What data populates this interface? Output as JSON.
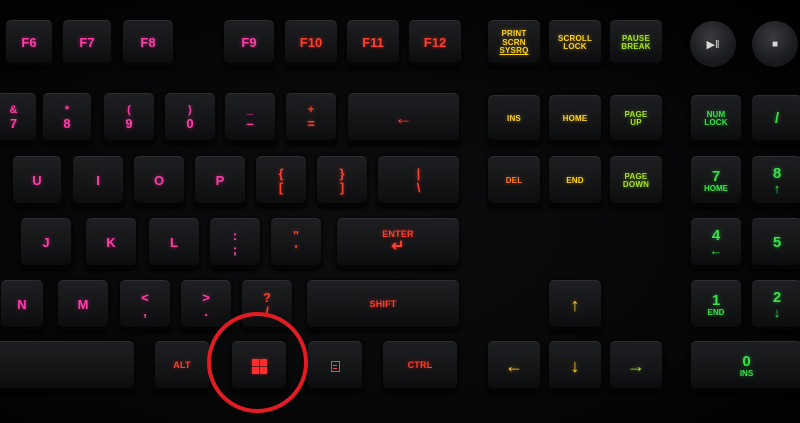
{
  "fkeys": {
    "f6": "F6",
    "f7": "F7",
    "f8": "F8",
    "f9": "F9",
    "f10": "F10",
    "f11": "F11",
    "f12": "F12"
  },
  "system": {
    "print_l1": "PRINT",
    "print_l2": "SCRN",
    "print_l3": "SYSRQ",
    "scroll_l1": "SCROLL",
    "scroll_l2": "LOCK",
    "pause_l1": "PAUSE",
    "pause_l2": "BREAK"
  },
  "media": {
    "play_pause": "▶ǁ",
    "stop": "■"
  },
  "numrow": {
    "k7_top": "&",
    "k7": "7",
    "k8_top": "*",
    "k8": "8",
    "k9_top": "(",
    "k9": "9",
    "k0_top": ")",
    "k0": "0",
    "minus_top": "_",
    "minus": "–",
    "equal_top": "+",
    "equal": "=",
    "backspace": "←"
  },
  "nav": {
    "ins": "INS",
    "home": "HOME",
    "pgup_l1": "PAGE",
    "pgup_l2": "UP",
    "del": "DEL",
    "end": "END",
    "pgdn_l1": "PAGE",
    "pgdn_l2": "DOWN"
  },
  "numpad": {
    "numlock_l1": "NUM",
    "numlock_l2": "LOCK",
    "slash": "/",
    "n7": "7",
    "n7_sub": "HOME",
    "n8": "8",
    "n8_sub": "↑",
    "n4": "4",
    "n4_sub": "←",
    "n5": "5",
    "n1": "1",
    "n1_sub": "END",
    "n2": "2",
    "n2_sub": "↓",
    "n0": "0",
    "n0_sub": "INS"
  },
  "toprow": {
    "u": "U",
    "i": "I",
    "o": "O",
    "p": "P",
    "lbrace_top": "{",
    "lbrace": "[",
    "rbrace_top": "}",
    "rbrace": "]",
    "pipe_top": "|",
    "pipe": "\\"
  },
  "homerow": {
    "j": "J",
    "k": "K",
    "l": "L",
    "colon_top": ":",
    "colon": ";",
    "quote_top": "\"",
    "quote": "'",
    "enter": "ENTER",
    "enter_arrow": "↵"
  },
  "bottomrow": {
    "n": "N",
    "m": "M",
    "lt": "<",
    "comma": ",",
    "gt": ">",
    "period": ".",
    "q_top": "?",
    "slash": "/",
    "shift": "SHIFT"
  },
  "spacerow": {
    "alt": "ALT",
    "ctrl": "CTRL"
  },
  "arrows": {
    "up": "↑",
    "left": "←",
    "down": "↓",
    "right": "→"
  },
  "colors": {
    "highlight_circle": "#e31b23",
    "pink": "#ff3ea8",
    "red": "#ff3f2e",
    "yellow": "#ffd21a",
    "green": "#36e34a"
  }
}
